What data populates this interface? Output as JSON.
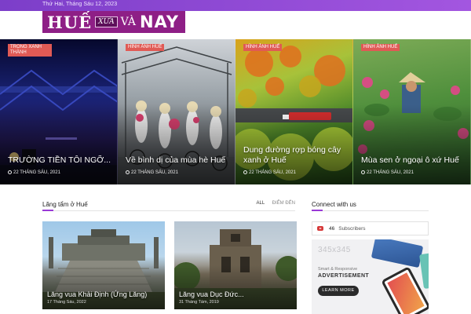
{
  "topbar": {
    "date": "Thứ Hai, Tháng Sáu 12, 2023"
  },
  "logo": {
    "part1": "HUẾ",
    "part2": "XƯA",
    "part3": "VÀ",
    "part4": "NAY"
  },
  "slider": [
    {
      "category": "TRONG XANH THÀNH",
      "title": "TRƯỜNG TIỀN TÔI NGỠ...",
      "date": "22 THÁNG SÁU, 2021"
    },
    {
      "category": "HÌNH ẢNH HUẾ",
      "title": "Về bình dị của mùa hè Huế",
      "date": "22 THÁNG SÁU, 2021"
    },
    {
      "category": "HÌNH ẢNH HUẾ",
      "title": "Dung đường rợp bóng cây xanh ở Huế",
      "date": "22 THÁNG SÁU, 2021"
    },
    {
      "category": "HÌNH ẢNH HUẾ",
      "title": "Mùa sen ở ngoại ô xứ Huế",
      "date": "22 THÁNG SÁU, 2021"
    }
  ],
  "section": {
    "title": "Lăng tẩm ở Huế",
    "tabs": [
      "ALL",
      "ĐIỂM ĐẾN"
    ],
    "cards": [
      {
        "title": "Lăng vua Khải Định (Ứng Lăng)",
        "date": "17 Tháng Sáu, 2022"
      },
      {
        "title": "Lăng vua Dục Đức...",
        "date": "31 Tháng Tám, 2019"
      }
    ]
  },
  "connect": {
    "title": "Connect with us",
    "subscribers_count": "46",
    "subscribers_label": "Subscribers",
    "ad": {
      "size": "345x345",
      "small": "Smart & Responsive",
      "big": "ADVERTISEMENT",
      "button": "LEARN MORE"
    }
  }
}
